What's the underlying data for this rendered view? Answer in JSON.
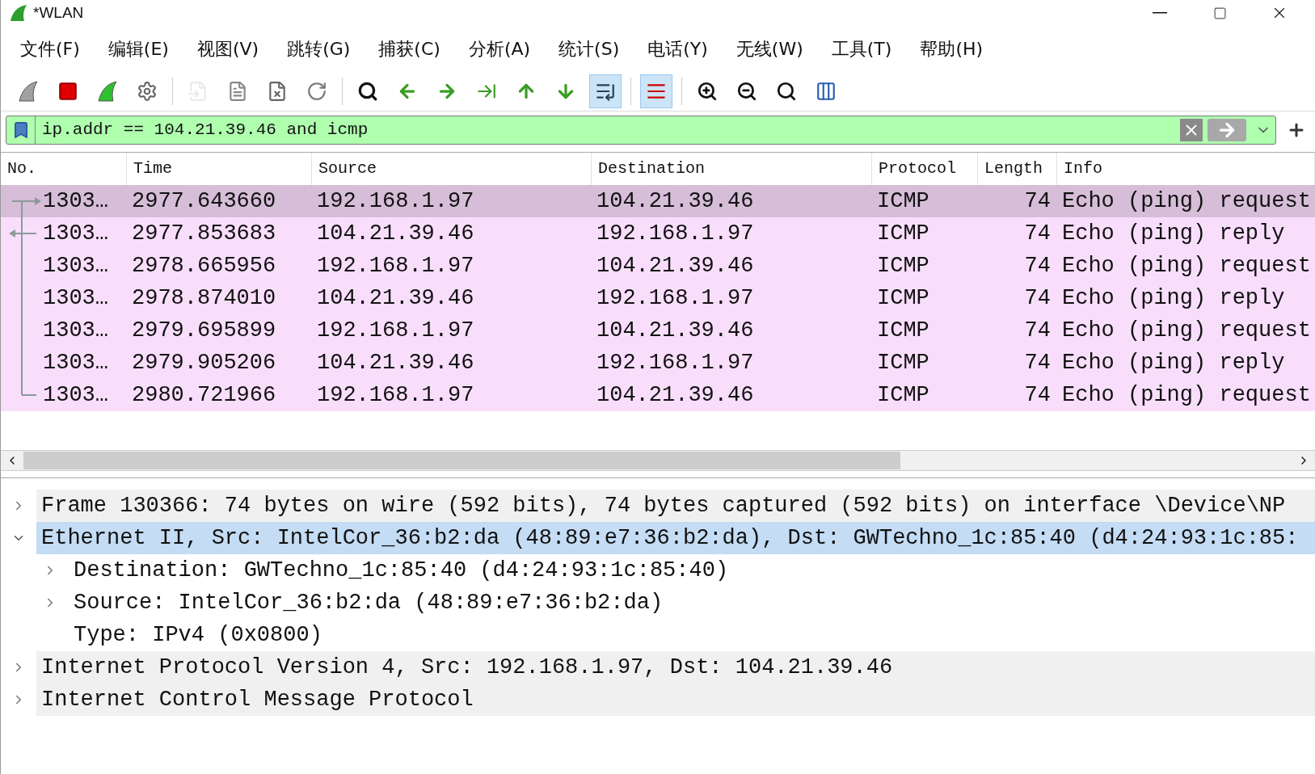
{
  "window": {
    "title": "*WLAN"
  },
  "menu": [
    "文件(F)",
    "编辑(E)",
    "视图(V)",
    "跳转(G)",
    "捕获(C)",
    "分析(A)",
    "统计(S)",
    "电话(Y)",
    "无线(W)",
    "工具(T)",
    "帮助(H)"
  ],
  "toolbar": [
    {
      "kind": "start",
      "pressed": false,
      "disabled": false
    },
    {
      "kind": "stop",
      "pressed": false,
      "disabled": false
    },
    {
      "kind": "restart",
      "pressed": false,
      "disabled": false
    },
    {
      "kind": "options",
      "pressed": false,
      "disabled": false
    },
    {
      "kind": "sep"
    },
    {
      "kind": "open",
      "pressed": false,
      "disabled": true
    },
    {
      "kind": "save",
      "pressed": false,
      "disabled": false
    },
    {
      "kind": "close",
      "pressed": false,
      "disabled": false
    },
    {
      "kind": "reload",
      "pressed": false,
      "disabled": false
    },
    {
      "kind": "sep"
    },
    {
      "kind": "find",
      "pressed": false,
      "disabled": false
    },
    {
      "kind": "back",
      "pressed": false,
      "disabled": false
    },
    {
      "kind": "forward",
      "pressed": false,
      "disabled": false
    },
    {
      "kind": "goto",
      "pressed": false,
      "disabled": false
    },
    {
      "kind": "first",
      "pressed": false,
      "disabled": false
    },
    {
      "kind": "last",
      "pressed": false,
      "disabled": false
    },
    {
      "kind": "autoscroll",
      "pressed": true,
      "disabled": false
    },
    {
      "kind": "sep"
    },
    {
      "kind": "colorize",
      "pressed": true,
      "disabled": false
    },
    {
      "kind": "sep"
    },
    {
      "kind": "zoomin",
      "pressed": false,
      "disabled": false
    },
    {
      "kind": "zoomout",
      "pressed": false,
      "disabled": false
    },
    {
      "kind": "zoomnormal",
      "pressed": false,
      "disabled": false
    },
    {
      "kind": "resize",
      "pressed": false,
      "disabled": false
    }
  ],
  "filter": {
    "value": "ip.addr == 104.21.39.46 and icmp"
  },
  "packet_list": {
    "columns": [
      "No.",
      "Time",
      "Source",
      "Destination",
      "Protocol",
      "Length",
      "Info"
    ],
    "rows": [
      {
        "selected": true,
        "cells": [
          "1303…",
          "2977.643660",
          "192.168.1.97",
          "104.21.39.46",
          "ICMP",
          "74",
          "Echo (ping) request"
        ]
      },
      {
        "selected": false,
        "cells": [
          "1303…",
          "2977.853683",
          "104.21.39.46",
          "192.168.1.97",
          "ICMP",
          "74",
          "Echo (ping) reply"
        ]
      },
      {
        "selected": false,
        "cells": [
          "1303…",
          "2978.665956",
          "192.168.1.97",
          "104.21.39.46",
          "ICMP",
          "74",
          "Echo (ping) request"
        ]
      },
      {
        "selected": false,
        "cells": [
          "1303…",
          "2978.874010",
          "104.21.39.46",
          "192.168.1.97",
          "ICMP",
          "74",
          "Echo (ping) reply"
        ]
      },
      {
        "selected": false,
        "cells": [
          "1303…",
          "2979.695899",
          "192.168.1.97",
          "104.21.39.46",
          "ICMP",
          "74",
          "Echo (ping) request"
        ]
      },
      {
        "selected": false,
        "cells": [
          "1303…",
          "2979.905206",
          "104.21.39.46",
          "192.168.1.97",
          "ICMP",
          "74",
          "Echo (ping) reply"
        ]
      },
      {
        "selected": false,
        "cells": [
          "1303…",
          "2980.721966",
          "192.168.1.97",
          "104.21.39.46",
          "ICMP",
          "74",
          "Echo (ping) request"
        ]
      }
    ]
  },
  "details": [
    {
      "text": "Frame 130366: 74 bytes on wire (592 bits), 74 bytes captured (592 bits) on interface \\Device\\NP",
      "expanded": false,
      "selected": false
    },
    {
      "text": "Ethernet II, Src: IntelCor_36:b2:da (48:89:e7:36:b2:da), Dst: GWTechno_1c:85:40 (d4:24:93:1c:85:",
      "expanded": true,
      "selected": true,
      "children": [
        {
          "text": "Destination: GWTechno_1c:85:40 (d4:24:93:1c:85:40)",
          "expanded": false,
          "selected": false
        },
        {
          "text": "Source: IntelCor_36:b2:da (48:89:e7:36:b2:da)",
          "expanded": false,
          "selected": false
        },
        {
          "text": "Type: IPv4 (0x0800)",
          "selected": false
        }
      ]
    },
    {
      "text": "Internet Protocol Version 4, Src: 192.168.1.97, Dst: 104.21.39.46",
      "expanded": false,
      "selected": false
    },
    {
      "text": "Internet Control Message Protocol",
      "expanded": false,
      "selected": false
    }
  ]
}
